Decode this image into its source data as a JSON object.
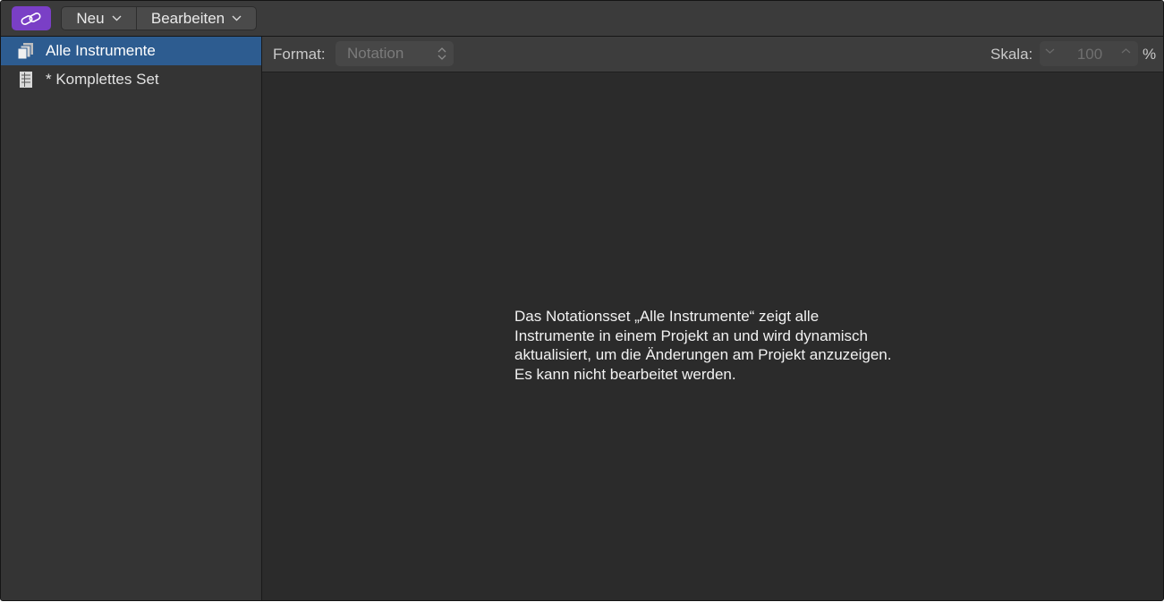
{
  "toolbar": {
    "link_icon": "link-icon",
    "neu_label": "Neu",
    "bearbeiten_label": "Bearbeiten",
    "chevron_icon": "chevron-down-icon"
  },
  "sidebar": {
    "items": [
      {
        "label": "Alle Instrumente",
        "icon": "multi-page-icon",
        "selected": true
      },
      {
        "label": "* Komplettes Set",
        "icon": "list-sheet-icon",
        "selected": false
      }
    ]
  },
  "main": {
    "format_label": "Format:",
    "format_value": "Notation",
    "scale_label": "Skala:",
    "scale_value": "100",
    "scale_unit": "%",
    "info_lines": [
      "Das Notationsset „Alle Instrumente“ zeigt alle",
      "Instrumente in einem Projekt an und wird dynamisch",
      "aktualisiert, um die Änderungen am Projekt anzuzeigen.",
      "Es kann nicht bearbeitet werden."
    ]
  },
  "colors": {
    "accent_purple": "#7a3fc6",
    "selection_blue": "#2d5c90",
    "window_bg": "#2b2b2b",
    "sidebar_bg": "#343434"
  }
}
